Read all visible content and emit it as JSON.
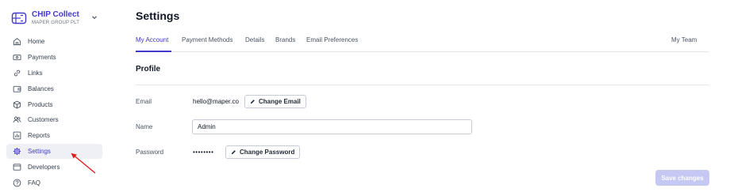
{
  "brand": {
    "name": "CHIP Collect",
    "subtitle": "MAPER GROUP PLT"
  },
  "sidebar": {
    "items": [
      {
        "label": "Home",
        "icon": "home-icon"
      },
      {
        "label": "Payments",
        "icon": "payments-icon"
      },
      {
        "label": "Links",
        "icon": "link-icon"
      },
      {
        "label": "Balances",
        "icon": "wallet-icon"
      },
      {
        "label": "Products",
        "icon": "box-icon"
      },
      {
        "label": "Customers",
        "icon": "users-icon"
      },
      {
        "label": "Reports",
        "icon": "chart-icon"
      },
      {
        "label": "Settings",
        "icon": "gear-icon",
        "active": true
      },
      {
        "label": "Developers",
        "icon": "window-icon"
      },
      {
        "label": "FAQ",
        "icon": "question-icon"
      }
    ]
  },
  "page": {
    "title": "Settings"
  },
  "tabs": {
    "items": [
      {
        "label": "My Account",
        "active": true
      },
      {
        "label": "Payment Methods"
      },
      {
        "label": "Details"
      },
      {
        "label": "Brands"
      },
      {
        "label": "Email Preferences"
      }
    ],
    "right": "My Team"
  },
  "profile": {
    "title": "Profile",
    "email_label": "Email",
    "email_value": "hello@maper.co",
    "change_email": "Change Email",
    "name_label": "Name",
    "name_value": "Admin",
    "password_label": "Password",
    "password_value": "••••••••",
    "change_password": "Change Password"
  },
  "actions": {
    "save": "Save changes"
  },
  "colors": {
    "accent": "#4338ca",
    "active_bg": "#eef0f6",
    "save_disabled": "#c4c8f2",
    "annotation": "#e11d1d"
  }
}
